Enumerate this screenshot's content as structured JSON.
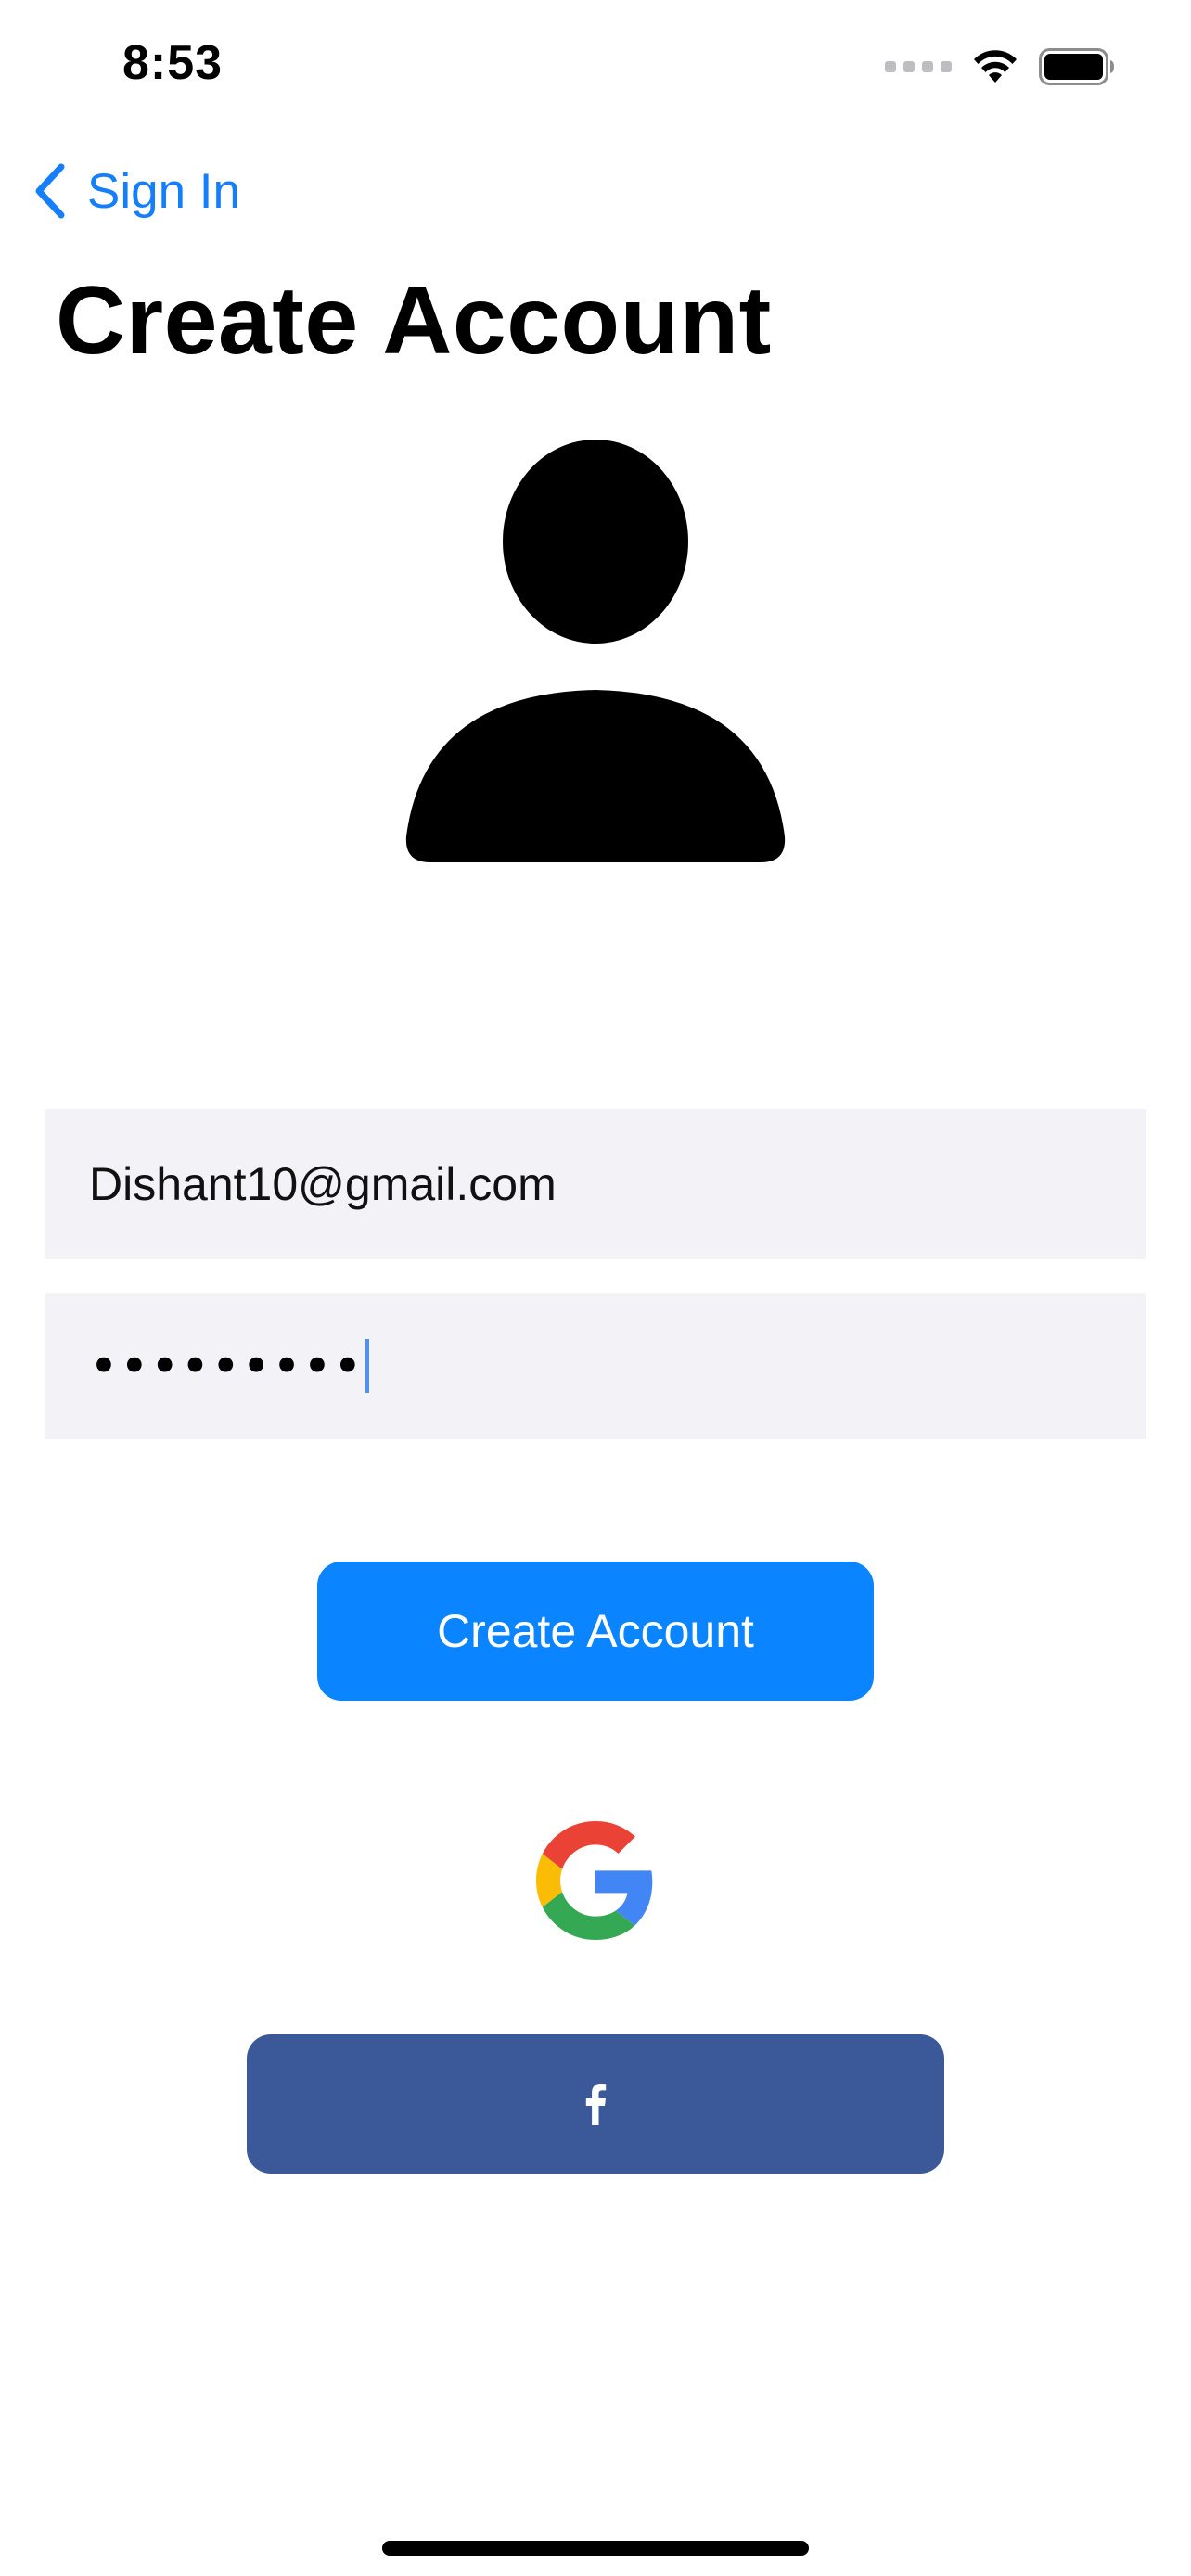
{
  "status_bar": {
    "time": "8:53",
    "icons": [
      "cellular-signal-icon",
      "wifi-icon",
      "battery-icon"
    ]
  },
  "nav": {
    "back_label": "Sign In",
    "back_icon": "chevron-left-icon"
  },
  "page": {
    "title": "Create Account",
    "avatar_icon": "person-icon"
  },
  "form": {
    "email_value": "Dishant10@gmail.com",
    "password_value": "•••••••••"
  },
  "buttons": {
    "create_account_label": "Create Account",
    "google_icon": "google-logo-icon",
    "facebook_label": "f"
  },
  "colors": {
    "accent": "#0a84ff",
    "back_link": "#157efb",
    "field_background": "#f2f2f7",
    "facebook": "#3b5998"
  }
}
